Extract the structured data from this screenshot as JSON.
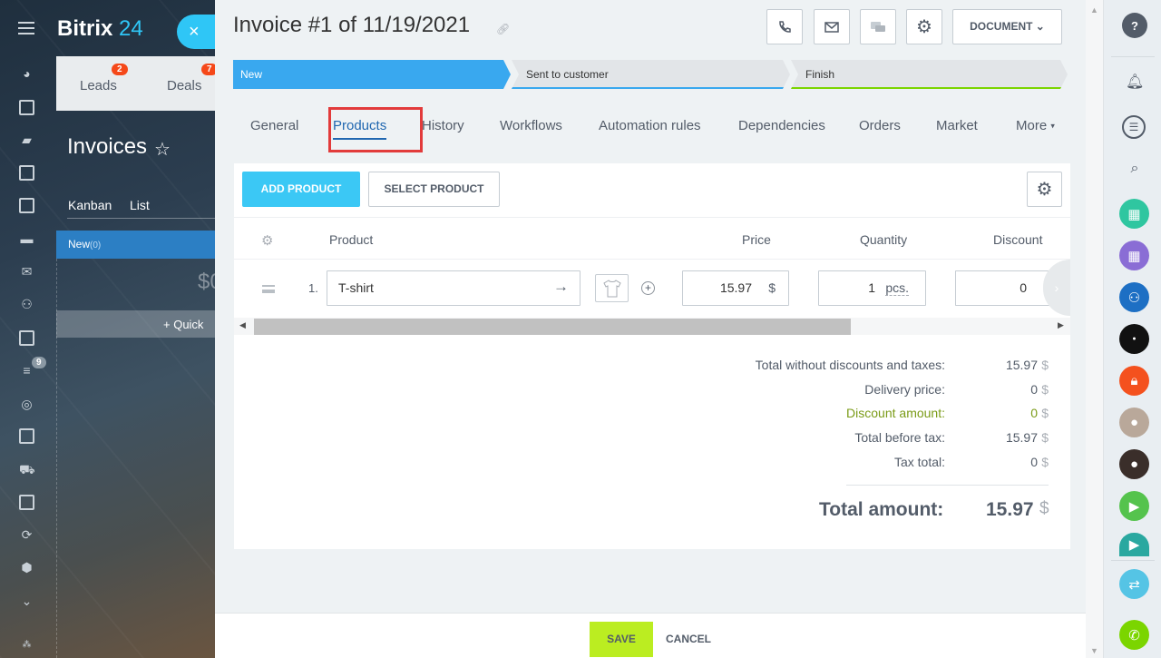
{
  "app": {
    "brand_name": "Bitrix",
    "brand_suffix": "24",
    "close_symbol": "×",
    "crm_tabs": [
      {
        "label": "Leads",
        "badge": "2"
      },
      {
        "label": "Deals",
        "badge": "7"
      }
    ],
    "page_title": "Invoices",
    "view_tabs": [
      "Kanban",
      "List"
    ],
    "kanban_stage": {
      "label": "New",
      "count": "(0)"
    },
    "kanban_amount": "$0",
    "quick_add": "+ Quick",
    "nav_counter": "9"
  },
  "document": {
    "title": "Invoice #1 of 11/19/2021",
    "header_buttons": [
      "phone-icon",
      "mail-icon",
      "chat-icon",
      "gear-icon"
    ],
    "document_button": "DOCUMENT",
    "stages": [
      "New",
      "Sent to customer",
      "Finish"
    ],
    "tabs": [
      "General",
      "Products",
      "History",
      "Workflows",
      "Automation rules",
      "Dependencies",
      "Orders",
      "Market",
      "More"
    ],
    "active_tab": "Products"
  },
  "products": {
    "add_button": "ADD PRODUCT",
    "select_button": "SELECT PRODUCT",
    "columns": [
      "Product",
      "Price",
      "Quantity",
      "Discount"
    ],
    "rows": [
      {
        "index": "1.",
        "name": "T-shirt",
        "price": "15.97",
        "currency": "$",
        "quantity": "1",
        "unit": "pcs.",
        "discount": "0",
        "discount_unit": "%"
      }
    ]
  },
  "totals": {
    "without_discounts": {
      "label": "Total without discounts and taxes:",
      "value": "15.97",
      "currency": "$"
    },
    "delivery": {
      "label": "Delivery price:",
      "value": "0",
      "currency": "$"
    },
    "discount": {
      "label": "Discount amount:",
      "value": "0",
      "currency": "$"
    },
    "before_tax": {
      "label": "Total before tax:",
      "value": "15.97",
      "currency": "$"
    },
    "tax": {
      "label": "Tax total:",
      "value": "0",
      "currency": "$"
    },
    "total": {
      "label": "Total amount:",
      "value": "15.97",
      "currency": "$"
    }
  },
  "footer": {
    "save": "SAVE",
    "cancel": "CANCEL"
  },
  "colors": {
    "accent": "#3bc8f5",
    "stage_active": "#39a8ef",
    "save": "#bbed21",
    "highlight": "#e23b3b"
  }
}
